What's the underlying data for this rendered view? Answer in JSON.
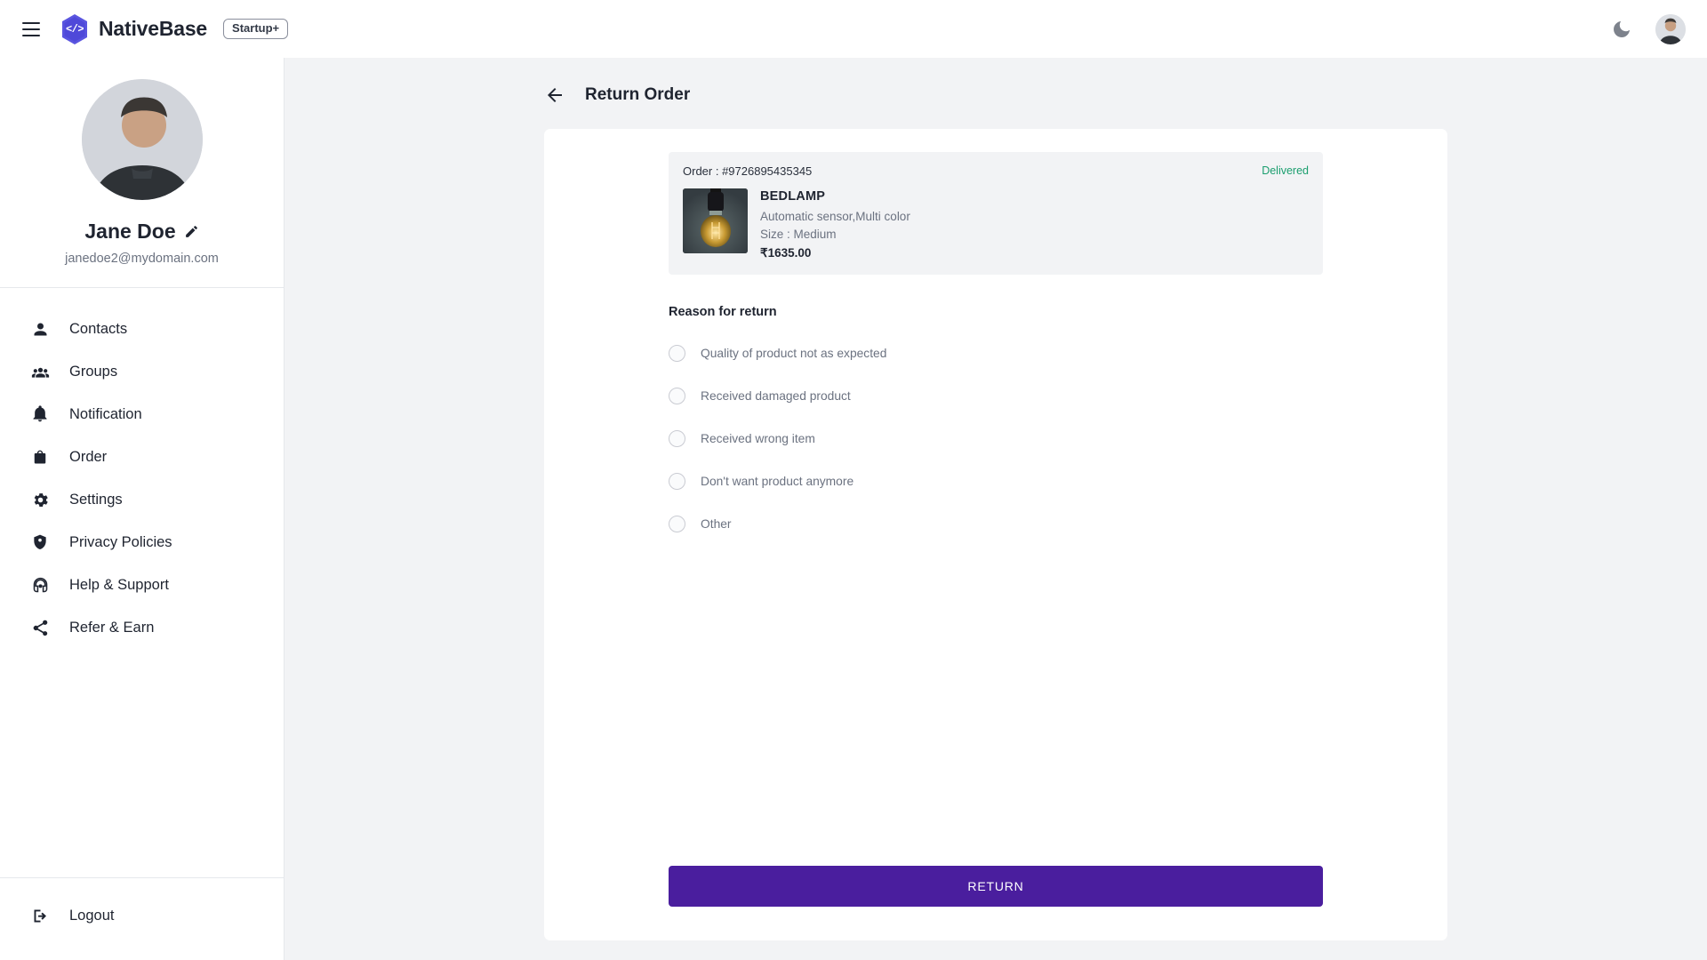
{
  "topbar": {
    "menu_icon": "hamburger-menu-icon",
    "logo_glyph": "</>",
    "brand_name": "NativeBase",
    "plan_badge": "Startup+",
    "theme_toggle_icon": "moon-icon",
    "avatar_icon": "user-avatar"
  },
  "sidebar": {
    "profile": {
      "avatar_icon": "profile-photo",
      "name": "Jane Doe",
      "edit_icon": "pencil-edit-icon",
      "email": "janedoe2@mydomain.com"
    },
    "items": [
      {
        "label": "Contacts",
        "icon": "person-icon"
      },
      {
        "label": "Groups",
        "icon": "people-group-icon"
      },
      {
        "label": "Notification",
        "icon": "bell-icon"
      },
      {
        "label": "Order",
        "icon": "shopping-bag-icon"
      },
      {
        "label": "Settings",
        "icon": "gear-icon"
      },
      {
        "label": "Privacy Policies",
        "icon": "shield-icon"
      },
      {
        "label": "Help & Support",
        "icon": "headset-icon"
      },
      {
        "label": "Refer & Earn",
        "icon": "share-icon"
      }
    ],
    "logout": {
      "label": "Logout",
      "icon": "logout-icon"
    }
  },
  "page": {
    "back_icon": "arrow-left-icon",
    "title": "Return Order"
  },
  "order": {
    "order_id_label": "Order : #9726895435345",
    "status": "Delivered",
    "status_color": "#1a9e6e",
    "product": {
      "image_icon": "bedlamp-product-photo",
      "name": "BEDLAMP",
      "description": "Automatic sensor,Multi color",
      "size": "Size : Medium",
      "price": "₹1635.00"
    }
  },
  "return_form": {
    "section_title": "Reason for return",
    "options": [
      {
        "label": "Quality of product not as expected",
        "selected": false
      },
      {
        "label": "Received damaged product",
        "selected": false
      },
      {
        "label": "Received wrong item",
        "selected": false
      },
      {
        "label": "Don't want product anymore",
        "selected": false
      },
      {
        "label": "Other",
        "selected": false
      }
    ],
    "submit_label": "RETURN",
    "submit_color": "#4a1e9e"
  }
}
